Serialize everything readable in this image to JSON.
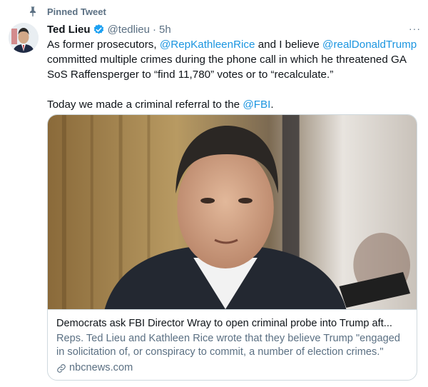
{
  "pinned": {
    "label": "Pinned Tweet",
    "icon": "pin-icon"
  },
  "author": {
    "name": "Ted Lieu",
    "handle": "@tedlieu",
    "separator": "·",
    "time": "5h",
    "verified_icon": "verified-badge-icon"
  },
  "more_label": "···",
  "tweet": {
    "p1": {
      "t1": "As former prosecutors, ",
      "m1": "@RepKathleenRice",
      "t2": " and I believe ",
      "m2": "@realDonaldTrump",
      "t3": " committed multiple crimes during the phone call in which he threatened GA SoS Raffensperger to “find 11,780” votes or to “recalculate.”"
    },
    "p2": {
      "t1": "Today we made a criminal referral to the ",
      "m1": "@FBI",
      "t2": "."
    }
  },
  "card": {
    "title": "Democrats ask FBI Director Wray to open criminal probe into Trump aft...",
    "description": "Reps. Ted Lieu and Kathleen Rice wrote that they believe Trump \"engaged in solicitation of, or conspiracy to commit, a number of election crimes.\"",
    "domain": "nbcnews.com",
    "domain_icon": "link-icon"
  },
  "colors": {
    "link": "#1b95e0",
    "secondary_text": "#5b7083",
    "primary_text": "#0f1419",
    "border": "#cfd9de",
    "verified": "#1da1f2"
  }
}
